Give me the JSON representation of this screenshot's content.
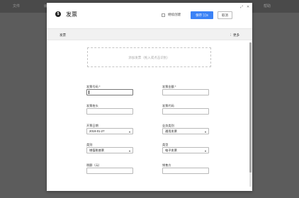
{
  "background": {
    "menu_items": [
      "文件",
      "编辑",
      "视图",
      "帮助"
    ]
  },
  "modal": {
    "icon": "invoice-icon",
    "title": "发票",
    "keep_create_label": "继续创建",
    "save_label": "保存 ⌘S",
    "cancel_label": "取消",
    "expand_icon": "expand-icon",
    "close_icon": "close-icon"
  },
  "subbar": {
    "title": "发票",
    "more_label": "⋮ 更多"
  },
  "upload": {
    "placeholder": "添加发票（拖入或点击识别）"
  },
  "form": {
    "invoice_number": {
      "label": "发票号码 *",
      "value": ""
    },
    "invoice_amount": {
      "label": "发票金额 *",
      "value": ""
    },
    "invoice_header": {
      "label": "发票抬头",
      "value": ""
    },
    "invoice_code": {
      "label": "发票代码",
      "value": ""
    },
    "issue_date": {
      "label": "开票日期",
      "value": "2019-01-27"
    },
    "business_category": {
      "label": "业务类别",
      "value": "通用发票"
    },
    "category": {
      "label": "类别",
      "value": "增值税普票"
    },
    "type": {
      "label": "类型",
      "value": "电子发票"
    },
    "tax_amount": {
      "label": "税额（元）",
      "value": ""
    },
    "seller": {
      "label": "销售方",
      "value": ""
    }
  },
  "colors": {
    "primary": "#3b82f6",
    "overlay": "#5f5f5f"
  }
}
